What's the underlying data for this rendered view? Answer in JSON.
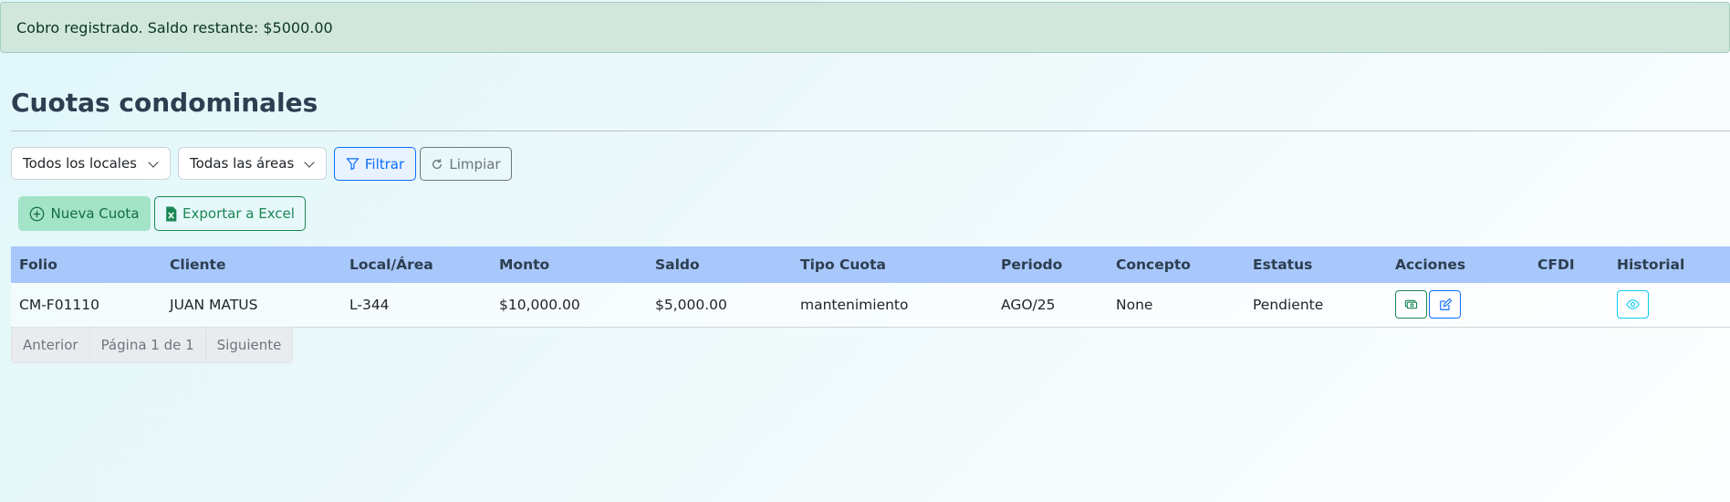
{
  "alert": {
    "message": "Cobro registrado. Saldo restante: $5000.00"
  },
  "page": {
    "title": "Cuotas condominales"
  },
  "filters": {
    "locales_selected": "Todos los locales",
    "areas_selected": "Todas las áreas",
    "filter_label": "Filtrar",
    "clear_label": "Limpiar"
  },
  "actions": {
    "new_label": "Nueva Cuota",
    "export_label": "Exportar a Excel"
  },
  "table": {
    "headers": [
      "Folio",
      "Cliente",
      "Local/Área",
      "Monto",
      "Saldo",
      "Tipo Cuota",
      "Periodo",
      "Concepto",
      "Estatus",
      "Acciones",
      "CFDI",
      "Historial"
    ],
    "rows": [
      {
        "folio": "CM-F01110",
        "cliente": "JUAN MATUS",
        "local": "L-344",
        "monto": "$10,000.00",
        "saldo": "$5,000.00",
        "tipo": "mantenimiento",
        "periodo": "AGO/25",
        "concepto": "None",
        "estatus": "Pendiente",
        "cfdi": ""
      }
    ]
  },
  "pagination": {
    "prev_label": "Anterior",
    "page_label": "Página 1 de 1",
    "next_label": "Siguiente"
  },
  "colors": {
    "alert_bg": "#d1e7dd",
    "header_bg": "#a8c7fa",
    "primary": "#0d6efd",
    "success": "#198754",
    "info": "#0dcaf0"
  },
  "icons": [
    "plus-circle-icon",
    "excel-file-icon",
    "filter-icon",
    "refresh-icon",
    "cash-icon",
    "edit-icon",
    "eye-icon",
    "chevron-down-icon"
  ]
}
